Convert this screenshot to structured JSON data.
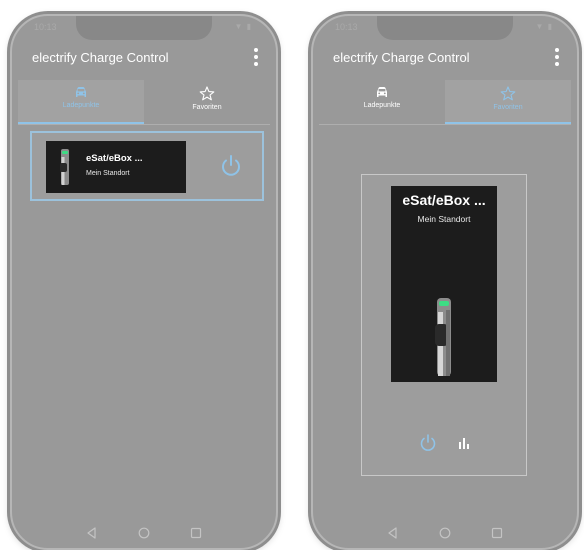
{
  "phones": [
    {
      "status": {
        "time": "10:13",
        "icons": "▼ ▮"
      },
      "app": {
        "title": "electrify Charge Control"
      },
      "tabs": [
        {
          "label": "Ladepunkte",
          "icon": "car-icon",
          "active": true
        },
        {
          "label": "Favoriten",
          "icon": "star-icon",
          "active": false
        }
      ],
      "station": {
        "name": "eSat/eBox ...",
        "location": "Mein Standort"
      }
    },
    {
      "status": {
        "time": "10:13",
        "icons": "▼ ▮"
      },
      "app": {
        "title": "electrify Charge Control"
      },
      "tabs": [
        {
          "label": "Ladepunkte",
          "icon": "car-icon",
          "active": false
        },
        {
          "label": "Favoriten",
          "icon": "star-icon",
          "active": true
        }
      ],
      "station": {
        "name": "eSat/eBox ...",
        "location": "Mein Standort"
      }
    }
  ],
  "colors": {
    "accent": "#8fc3e8",
    "screen": "#999999",
    "card": "#1c1c1c",
    "led": "#3ddc84"
  }
}
